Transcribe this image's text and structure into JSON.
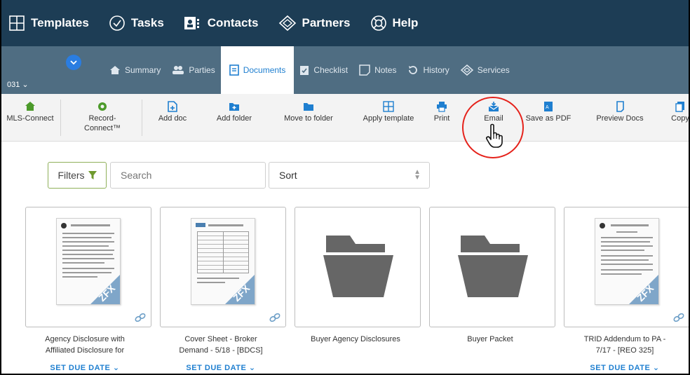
{
  "topnav": {
    "items": [
      {
        "label": "Templates",
        "icon": "templates-grid-icon"
      },
      {
        "label": "Tasks",
        "icon": "check-circle-icon"
      },
      {
        "label": "Contacts",
        "icon": "contacts-card-icon"
      },
      {
        "label": "Partners",
        "icon": "handshake-icon"
      },
      {
        "label": "Help",
        "icon": "lifebuoy-icon"
      }
    ]
  },
  "transaction": {
    "id_label": "031",
    "tabs": [
      {
        "label": "Summary",
        "icon": "home-icon",
        "active": false
      },
      {
        "label": "Parties",
        "icon": "users-icon",
        "active": false
      },
      {
        "label": "Documents",
        "icon": "document-icon",
        "active": true
      },
      {
        "label": "Checklist",
        "icon": "checklist-icon",
        "active": false
      },
      {
        "label": "Notes",
        "icon": "note-icon",
        "active": false
      },
      {
        "label": "History",
        "icon": "history-icon",
        "active": false
      },
      {
        "label": "Services",
        "icon": "handshake-icon",
        "active": false
      }
    ]
  },
  "toolbar": {
    "items": [
      {
        "label": "MLS-Connect",
        "icon": "mls-connect-icon"
      },
      {
        "label": "Record-Connect™",
        "icon": "record-connect-icon"
      },
      {
        "label": "Add doc",
        "icon": "add-doc-icon"
      },
      {
        "label": "Add folder",
        "icon": "add-folder-icon"
      },
      {
        "label": "Move to folder",
        "icon": "move-folder-icon"
      },
      {
        "label": "Apply template",
        "icon": "template-icon"
      },
      {
        "label": "Print",
        "icon": "print-icon"
      },
      {
        "label": "Email",
        "icon": "email-icon"
      },
      {
        "label": "Save as PDF",
        "icon": "pdf-icon"
      },
      {
        "label": "Preview Docs",
        "icon": "preview-icon"
      },
      {
        "label": "Copy",
        "icon": "copy-icon"
      }
    ]
  },
  "filters": {
    "filters_label": "Filters",
    "search_placeholder": "Search",
    "sort_label": "Sort"
  },
  "cards": [
    {
      "type": "document",
      "title_lines": [
        "Agency Disclosure with",
        "Affiliated Disclosure for"
      ],
      "due": "SET DUE DATE",
      "badge": "ZFX"
    },
    {
      "type": "document",
      "title_lines": [
        "Cover Sheet - Broker",
        "Demand - 5/18 - [BDCS]"
      ],
      "due": "SET DUE DATE",
      "badge": "ZFX"
    },
    {
      "type": "folder",
      "title_lines": [
        "Buyer Agency Disclosures",
        ""
      ],
      "due": ""
    },
    {
      "type": "folder",
      "title_lines": [
        "Buyer Packet",
        ""
      ],
      "due": ""
    },
    {
      "type": "document",
      "title_lines": [
        "TRID Addendum to PA -",
        "7/17 - [REO 325]"
      ],
      "due": "SET DUE DATE",
      "badge": "ZFX"
    }
  ],
  "colors": {
    "topnav_bg": "#1d3d55",
    "tabbar_bg": "#4f6d82",
    "accent": "#1f7fd0",
    "highlight": "#e5221b"
  }
}
